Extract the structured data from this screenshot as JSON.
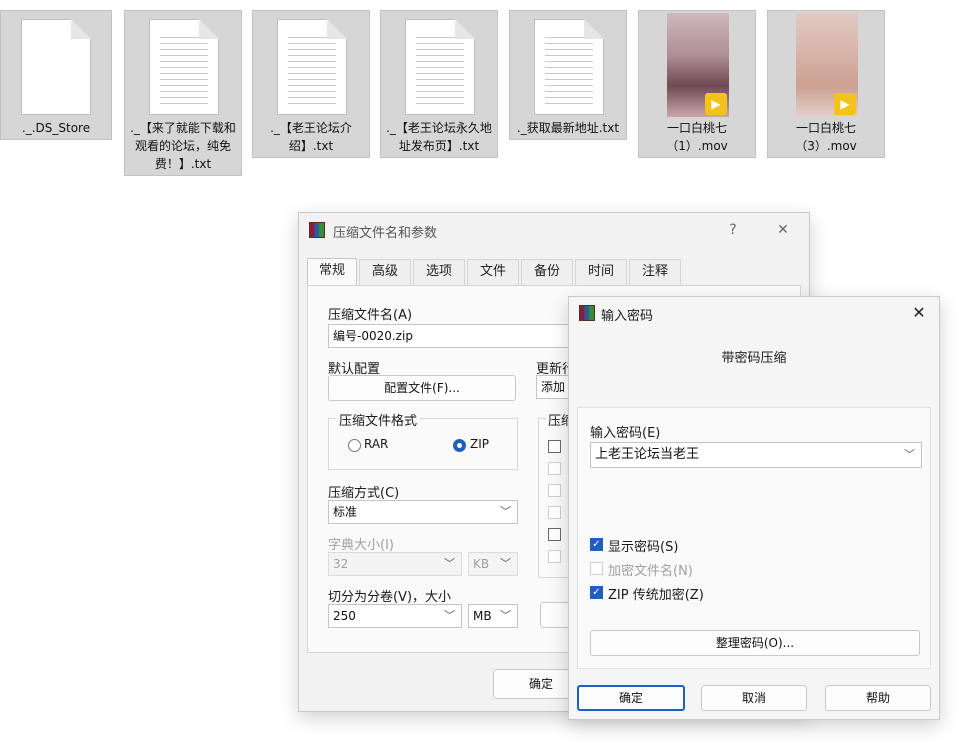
{
  "files": [
    {
      "name": "._.DS_Store",
      "kind": "blank-doc"
    },
    {
      "name": "._【来了就能下载和观看的论坛，纯免费！】.txt",
      "kind": "text-doc"
    },
    {
      "name": "._【老王论坛介绍】.txt",
      "kind": "text-doc"
    },
    {
      "name": "._【老王论坛永久地址发布页】.txt",
      "kind": "text-doc"
    },
    {
      "name": "._获取最新地址.txt",
      "kind": "text-doc"
    },
    {
      "name": "一口白桃七（1）.mov",
      "kind": "video",
      "badge": "Player"
    },
    {
      "name": "一口白桃七（3）.mov",
      "kind": "video",
      "badge": "Player"
    }
  ],
  "main_dialog": {
    "title": "压缩文件名和参数",
    "help_glyph": "?",
    "close_glyph": "✕",
    "tabs": [
      "常规",
      "高级",
      "选项",
      "文件",
      "备份",
      "时间",
      "注释"
    ],
    "archive_name_label": "压缩文件名(A)",
    "archive_name_value": "编号-0020.zip",
    "default_profile_label": "默认配置",
    "profiles_button": "配置文件(F)...",
    "update_mode_label": "更新行",
    "update_mode_value": "添加",
    "format_group_label": "压缩文件格式",
    "format_rar": "RAR",
    "format_zip": "ZIP",
    "options_group_label": "压缩",
    "method_label": "压缩方式(C)",
    "method_value": "标准",
    "dict_label": "字典大小(I)",
    "dict_value": "32",
    "dict_unit": "KB",
    "split_label": "切分为分卷(V)，大小",
    "split_value": "250",
    "split_unit": "MB",
    "ok_button": "确定"
  },
  "password_dialog": {
    "title": "输入密码",
    "close_glyph": "✕",
    "heading": "带密码压缩",
    "password_label": "输入密码(E)",
    "password_value": "上老王论坛当老王",
    "show_password": "显示密码(S)",
    "encrypt_names": "加密文件名(N)",
    "zip_legacy": "ZIP 传统加密(Z)",
    "organize_button": "整理密码(O)...",
    "ok_button": "确定",
    "cancel_button": "取消",
    "help_button": "帮助"
  }
}
